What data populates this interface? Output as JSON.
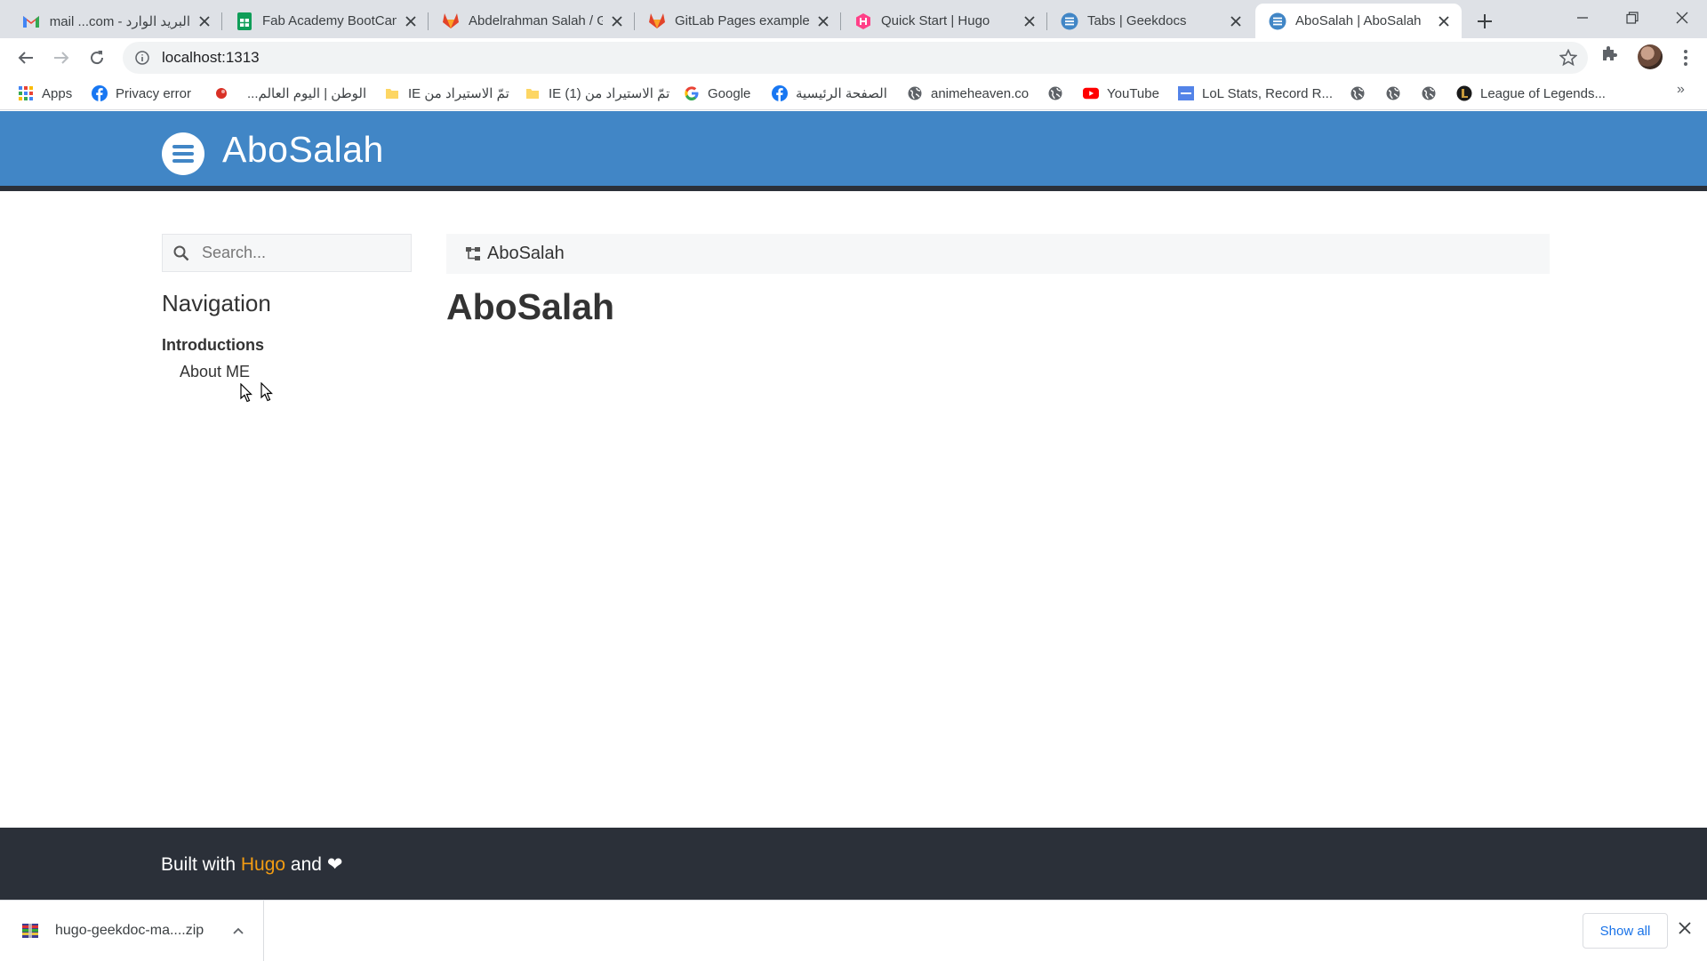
{
  "browser": {
    "tabs": [
      {
        "label": "البريد الوارد - Gmail ...com",
        "icon": "gmail-icon",
        "active": false
      },
      {
        "label": "Fab Academy BootCamp",
        "icon": "google-sheets-icon",
        "active": false
      },
      {
        "label": "Abdelrahman Salah / GitLab",
        "icon": "gitlab-icon",
        "active": false
      },
      {
        "label": "GitLab Pages examples",
        "icon": "gitlab-icon",
        "active": false
      },
      {
        "label": "Quick Start | Hugo",
        "icon": "hugo-icon",
        "active": false
      },
      {
        "label": "Tabs | Geekdocs",
        "icon": "geekdocs-icon",
        "active": false
      },
      {
        "label": "AboSalah | AboSalah",
        "icon": "geekdocs-icon",
        "active": true
      }
    ],
    "url": "localhost:1313",
    "bookmarks": [
      {
        "label": "Apps",
        "icon": "apps-grid-icon"
      },
      {
        "label": "Privacy error",
        "icon": "facebook-icon"
      },
      {
        "label": "",
        "icon": "red-dot-icon"
      },
      {
        "label": "الوطن | اليوم العالم...",
        "icon": ""
      },
      {
        "label": "تمّ الاستيراد من IE",
        "icon": "folder-icon"
      },
      {
        "label": "تمّ الاستيراد من IE (1)",
        "icon": "folder-icon"
      },
      {
        "label": "Google",
        "icon": "google-icon"
      },
      {
        "label": "الصفحة الرئيسية",
        "icon": "facebook-icon"
      },
      {
        "label": "animeheaven.co",
        "icon": "globe-icon"
      },
      {
        "label": "",
        "icon": "globe-icon"
      },
      {
        "label": "YouTube",
        "icon": "youtube-icon"
      },
      {
        "label": "LoL Stats, Record R...",
        "icon": "opgg-icon"
      },
      {
        "label": "",
        "icon": "globe-icon"
      },
      {
        "label": "",
        "icon": "globe-icon"
      },
      {
        "label": "",
        "icon": "globe-icon"
      },
      {
        "label": "League of Legends...",
        "icon": "lol-icon"
      }
    ],
    "bookmarks_overflow": "»"
  },
  "site": {
    "title": "AboSalah",
    "header_color": "#4186c6",
    "search_placeholder": "Search...",
    "nav_heading": "Navigation",
    "nav_section": "Introductions",
    "nav_items": [
      "About ME"
    ],
    "breadcrumb": "AboSalah",
    "page_title": "AboSalah",
    "footer": {
      "prefix": "Built with",
      "link": "Hugo",
      "suffix": "and",
      "heart": "❤"
    }
  },
  "download_shelf": {
    "file_name": "hugo-geekdoc-ma....zip",
    "show_all": "Show all"
  }
}
